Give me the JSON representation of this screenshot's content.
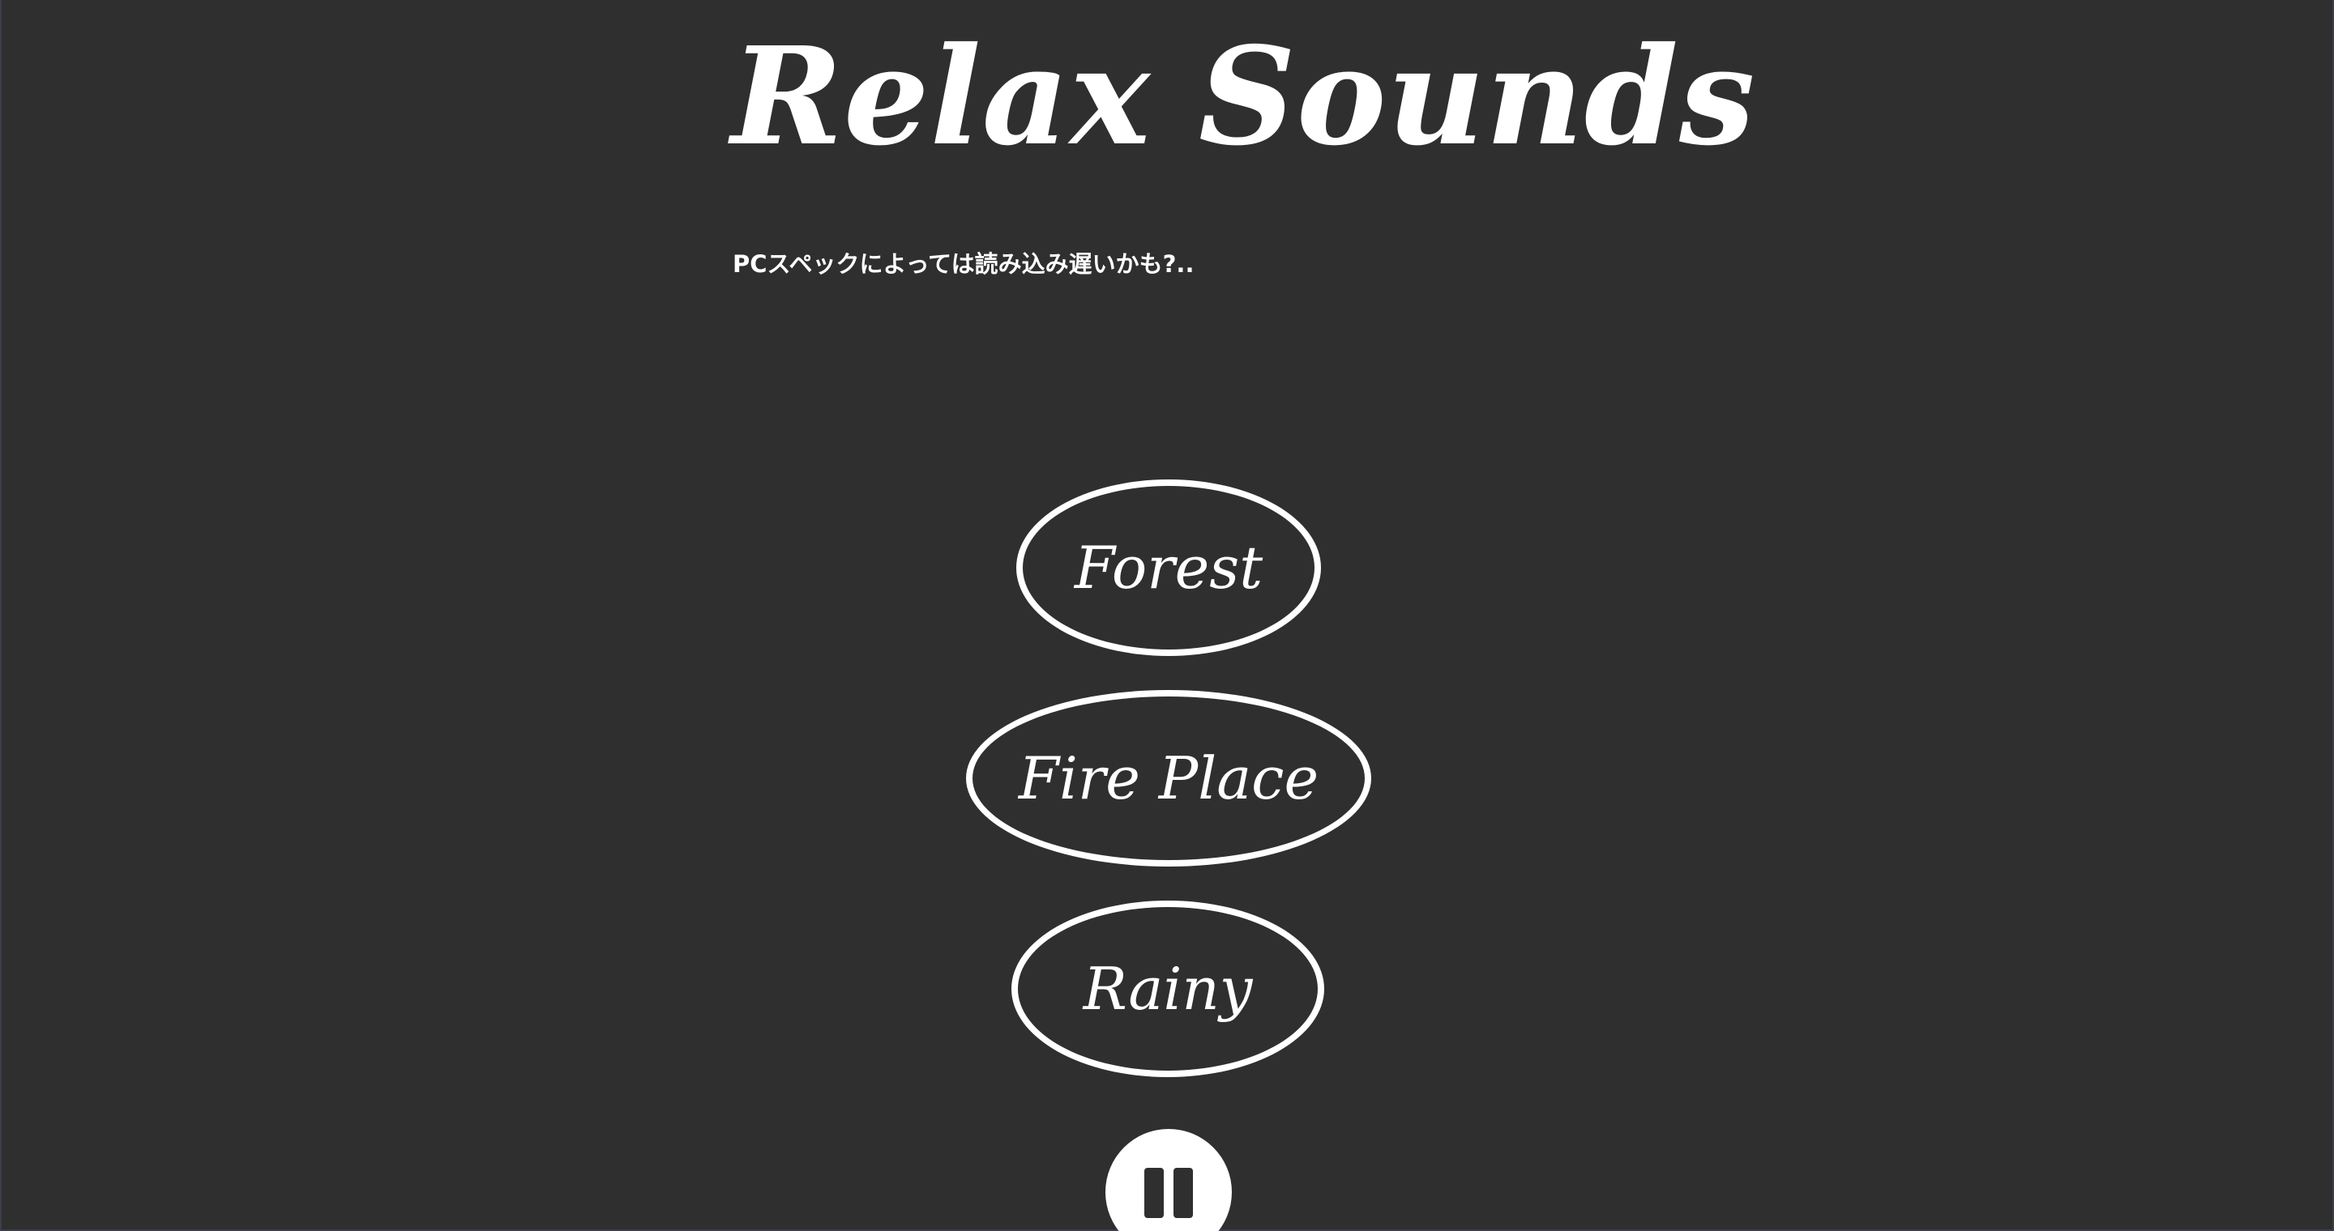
{
  "header": {
    "title": "Relax Sounds",
    "subtitle": "PCスペックによっては読み込み遅いかも?.."
  },
  "sounds": [
    {
      "label": "Forest"
    },
    {
      "label": "Fire Place"
    },
    {
      "label": "Rainy"
    }
  ],
  "controls": {
    "pause_icon": "pause-icon"
  },
  "colors": {
    "background": "#2f2f2f",
    "foreground": "#ffffff"
  }
}
